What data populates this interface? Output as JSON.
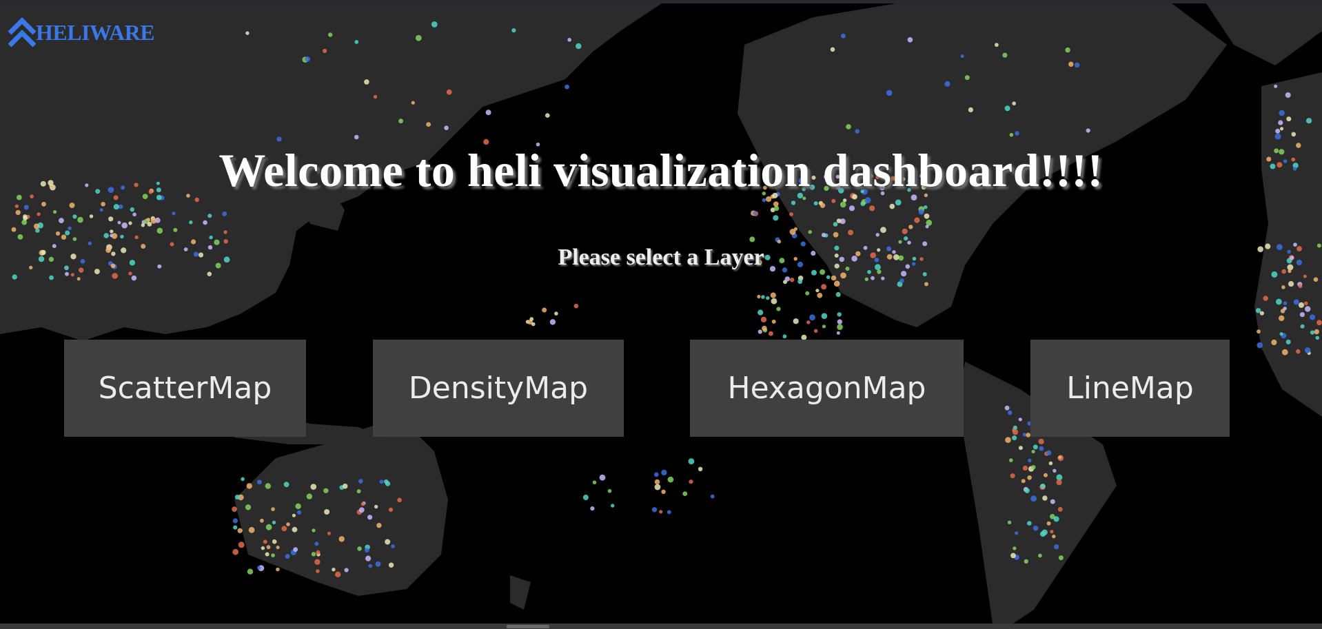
{
  "app": {
    "logo_text": "HELIWARE",
    "logo_icon": "double-chevron-up-icon",
    "brand_color": "#3a77e8"
  },
  "hero": {
    "title": "Welcome to heli visualization dashboard!!!!",
    "subtitle": "Please select a Layer"
  },
  "layers": {
    "scatter": "ScatterMap",
    "density": "DensityMap",
    "hexagon": "HexagonMap",
    "line": "LineMap"
  },
  "map": {
    "background": "dark world basemap",
    "land_color": "#2b2b2b",
    "point_colors": [
      "#f2b36b",
      "#4fd6c8",
      "#e46a4a",
      "#3a6ee0",
      "#7fd35a",
      "#c9b9ff",
      "#e9e9b5"
    ]
  }
}
